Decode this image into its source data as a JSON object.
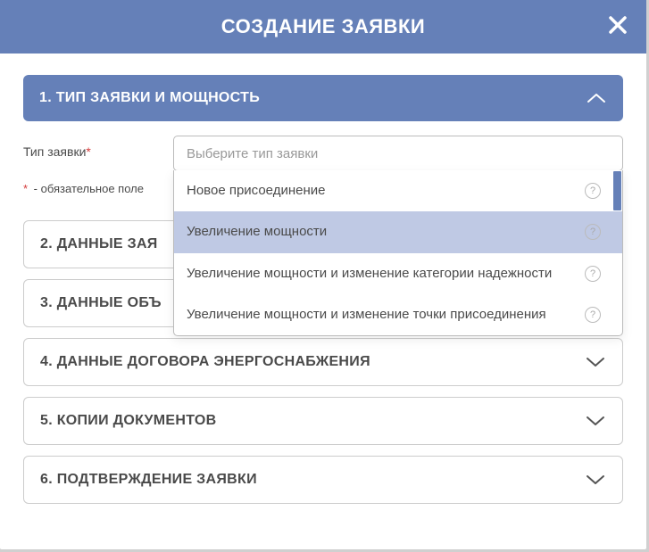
{
  "modal": {
    "title": "СОЗДАНИЕ ЗАЯВКИ"
  },
  "section1": {
    "title": "1. ТИП ЗАЯВКИ И МОЩНОСТЬ",
    "field_label": "Тип заявки",
    "required_mark": "*",
    "placeholder": "Выберите тип заявки",
    "required_note_prefix": "*",
    "required_note_text": " - обязательное поле",
    "options": [
      {
        "label": "Новое присоединение"
      },
      {
        "label": "Увеличение мощности"
      },
      {
        "label": "Увеличение мощности и изменение категории надежности"
      },
      {
        "label": "Увеличение мощности и изменение точки присоединения"
      }
    ]
  },
  "sections_collapsed": [
    {
      "title": "2. ДАННЫЕ ЗАЯ"
    },
    {
      "title": "3. ДАННЫЕ ОБЪ"
    },
    {
      "title": "4. ДАННЫЕ ДОГОВОРА ЭНЕРГОСНАБЖЕНИЯ"
    },
    {
      "title": "5. КОПИИ ДОКУМЕНТОВ"
    },
    {
      "title": "6. ПОДТВЕРЖДЕНИЕ ЗАЯВКИ"
    }
  ],
  "help_glyph": "?"
}
